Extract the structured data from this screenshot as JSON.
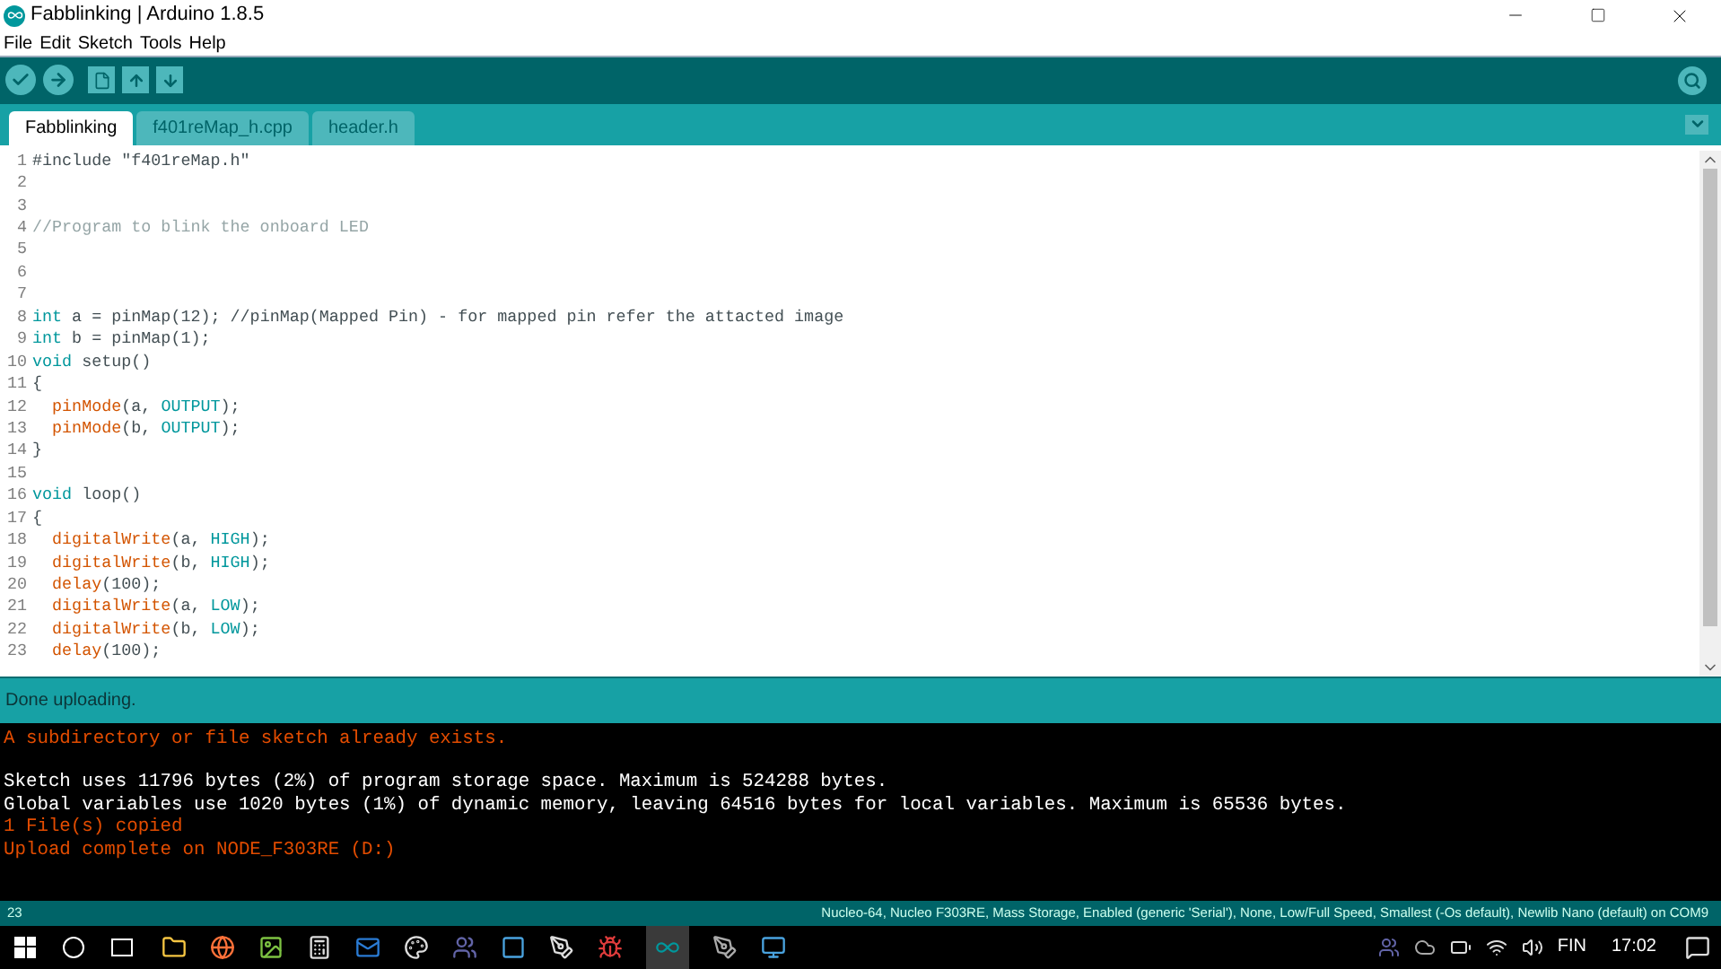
{
  "window": {
    "title": "Fabblinking | Arduino 1.8.5"
  },
  "menu": [
    "File",
    "Edit",
    "Sketch",
    "Tools",
    "Help"
  ],
  "tabs": [
    {
      "label": "Fabblinking",
      "selected": true
    },
    {
      "label": "f401reMap_h.cpp",
      "selected": false
    },
    {
      "label": "header.h",
      "selected": false
    }
  ],
  "editor": {
    "lines": [
      {
        "number": "1",
        "tokens": [
          {
            "text": "#include \"f401reMap.h\"",
            "kind": "plain"
          }
        ]
      },
      {
        "number": "2"
      },
      {
        "number": "3"
      },
      {
        "number": "4",
        "tokens": [
          {
            "text": "//Program to blink the onboard LED",
            "kind": "comment"
          }
        ]
      },
      {
        "number": "5"
      },
      {
        "number": "6"
      },
      {
        "number": "7"
      },
      {
        "number": "8",
        "tokens": [
          {
            "text": "int",
            "kind": "keyword"
          },
          {
            "text": " a = pinMap(12); //pinMap(Mapped Pin) - for mapped pin refer the attacted image",
            "kind": "plain"
          }
        ]
      },
      {
        "number": "9",
        "tokens": [
          {
            "text": "int",
            "kind": "keyword"
          },
          {
            "text": " b = pinMap(1);",
            "kind": "plain"
          }
        ]
      },
      {
        "number": "10",
        "tokens": [
          {
            "text": "void",
            "kind": "keyword"
          },
          {
            "text": " setup()",
            "kind": "plain"
          }
        ]
      },
      {
        "number": "11",
        "tokens": [
          {
            "text": "{",
            "kind": "plain"
          }
        ]
      },
      {
        "number": "12",
        "tokens": [
          {
            "text": "  pinMode",
            "kind": "function"
          },
          {
            "text": "(a, ",
            "kind": "plain"
          },
          {
            "text": "OUTPUT",
            "kind": "constant"
          },
          {
            "text": ");",
            "kind": "plain"
          }
        ]
      },
      {
        "number": "13",
        "tokens": [
          {
            "text": "  pinMode",
            "kind": "function"
          },
          {
            "text": "(b, ",
            "kind": "plain"
          },
          {
            "text": "OUTPUT",
            "kind": "constant"
          },
          {
            "text": ");",
            "kind": "plain"
          }
        ]
      },
      {
        "number": "14",
        "tokens": [
          {
            "text": "}",
            "kind": "plain"
          }
        ]
      },
      {
        "number": "15"
      },
      {
        "number": "16",
        "tokens": [
          {
            "text": "void",
            "kind": "keyword"
          },
          {
            "text": " loop()",
            "kind": "plain"
          }
        ]
      },
      {
        "number": "17",
        "tokens": [
          {
            "text": "{",
            "kind": "plain"
          }
        ]
      },
      {
        "number": "18",
        "tokens": [
          {
            "text": "  digitalWrite",
            "kind": "function"
          },
          {
            "text": "(a, ",
            "kind": "plain"
          },
          {
            "text": "HIGH",
            "kind": "constant"
          },
          {
            "text": ");",
            "kind": "plain"
          }
        ]
      },
      {
        "number": "19",
        "tokens": [
          {
            "text": "  digitalWrite",
            "kind": "function"
          },
          {
            "text": "(b, ",
            "kind": "plain"
          },
          {
            "text": "HIGH",
            "kind": "constant"
          },
          {
            "text": ");",
            "kind": "plain"
          }
        ]
      },
      {
        "number": "20",
        "tokens": [
          {
            "text": "  delay",
            "kind": "function"
          },
          {
            "text": "(100);",
            "kind": "plain"
          }
        ]
      },
      {
        "number": "21",
        "tokens": [
          {
            "text": "  digitalWrite",
            "kind": "function"
          },
          {
            "text": "(a, ",
            "kind": "plain"
          },
          {
            "text": "LOW",
            "kind": "constant"
          },
          {
            "text": ");",
            "kind": "plain"
          }
        ]
      },
      {
        "number": "22",
        "tokens": [
          {
            "text": "  digitalWrite",
            "kind": "function"
          },
          {
            "text": "(b, ",
            "kind": "plain"
          },
          {
            "text": "LOW",
            "kind": "constant"
          },
          {
            "text": ");",
            "kind": "plain"
          }
        ]
      },
      {
        "number": "23",
        "tokens": [
          {
            "text": "  delay",
            "kind": "function"
          },
          {
            "text": "(100);",
            "kind": "plain"
          }
        ]
      }
    ]
  },
  "status": "Done uploading.",
  "console": [
    {
      "text": "A subdirectory or file sketch already exists.",
      "kind": "error"
    },
    {
      "kind": "blank"
    },
    {
      "text": "Sketch uses 11796 bytes (2%) of program storage space. Maximum is 524288 bytes.",
      "kind": "info"
    },
    {
      "text": "Global variables use 1020 bytes (1%) of dynamic memory, leaving 64516 bytes for local variables. Maximum is 65536 bytes.",
      "kind": "info"
    },
    {
      "text": "1 File(s) copied",
      "kind": "error"
    },
    {
      "text": "Upload complete on NODE_F303RE (D:)",
      "kind": "error"
    }
  ],
  "status_bar": {
    "line": "23",
    "board": "Nucleo-64, Nucleo F303RE, Mass Storage, Enabled (generic 'Serial'), None, Low/Full Speed, Smallest (-Os default), Newlib Nano (default) on COM9"
  },
  "taskbar": {
    "language": "FIN",
    "time": "17:02"
  }
}
